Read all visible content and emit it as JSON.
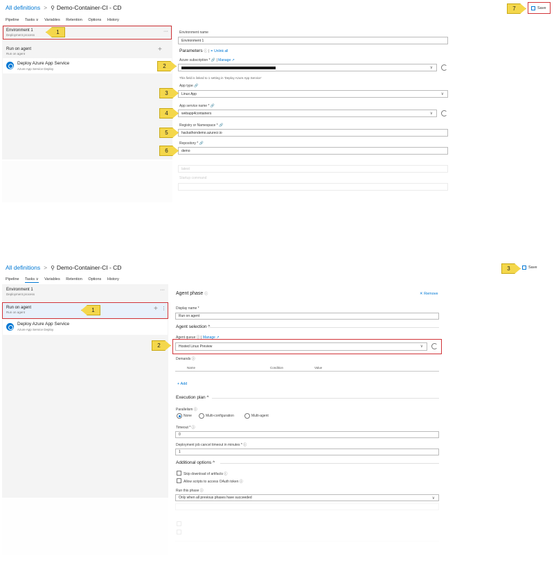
{
  "top": {
    "breadcrumb_link": "All definitions",
    "breadcrumb_sep": ">",
    "title": "Demo-Container-CI - CD",
    "tabs": [
      "Pipeline",
      "Tasks ∨",
      "Variables",
      "Retention",
      "Options",
      "History"
    ],
    "save_label": "Save",
    "environment": {
      "name": "Environment 1",
      "sub": "Deployment process"
    },
    "run_on_agent": {
      "name": "Run on agent",
      "sub": "Run on agent"
    },
    "task": {
      "name": "Deploy Azure App Service",
      "sub": "Azure App Service Deploy"
    },
    "form": {
      "env_name_label": "Environment name",
      "env_name_value": "Environment 1",
      "parameters_label": "Parameters",
      "unlink_all": "Unlink all",
      "azure_sub_label": "Azure subscription *",
      "manage": "Manage",
      "linked_note": "This field is linked to 1 setting in 'Deploy Azure App Service'",
      "app_type_label": "App type",
      "app_type_value": "Linux App",
      "app_service_label": "App service name *",
      "app_service_value": "webapp4containers",
      "registry_label": "Registry or Namespace *",
      "registry_value": "hackathondemo.azurecr.io",
      "repository_label": "Repository *",
      "repository_value": "demo",
      "faded_value": "latest",
      "faded_label": "Startup command"
    },
    "callouts": [
      "1",
      "2",
      "3",
      "4",
      "5",
      "6",
      "7"
    ]
  },
  "bottom": {
    "breadcrumb_link": "All definitions",
    "breadcrumb_sep": ">",
    "title": "Demo-Container-CI - CD",
    "tabs": [
      "Pipeline",
      "Tasks ∨",
      "Variables",
      "Retention",
      "Options",
      "History"
    ],
    "save_label": "Save",
    "environment": {
      "name": "Environment 1",
      "sub": "Deployment process"
    },
    "run_on_agent": {
      "name": "Run on agent",
      "sub": "Run on agent"
    },
    "task": {
      "name": "Deploy Azure App Service",
      "sub": "Azure App Service Deploy"
    },
    "form": {
      "phase_title": "Agent phase",
      "remove": "Remove",
      "display_name_label": "Display name *",
      "display_name_value": "Run on agent",
      "agent_selection": "Agent selection",
      "agent_queue_label": "Agent queue",
      "manage": "Manage",
      "agent_queue_value": "Hosted Linux Preview",
      "demands_label": "Demands",
      "demand_headers": [
        "Name",
        "Condition",
        "Value"
      ],
      "add": "Add",
      "execution_plan": "Execution plan",
      "parallelism_label": "Parallelism",
      "parallelism_options": [
        "None",
        "Multi-configuration",
        "Multi-agent"
      ],
      "timeout_label": "Timeout *",
      "timeout_value": "0",
      "cancel_timeout_label": "Deployment job cancel timeout in minutes *",
      "cancel_timeout_value": "1",
      "additional_options": "Additional options",
      "skip_download": "Skip download of artifacts",
      "allow_oauth": "Allow scripts to access OAuth token",
      "run_this_phase_label": "Run this phase",
      "run_this_phase_value": "Only when all previous phases have succeeded"
    },
    "callouts": [
      "1",
      "2",
      "3"
    ]
  }
}
